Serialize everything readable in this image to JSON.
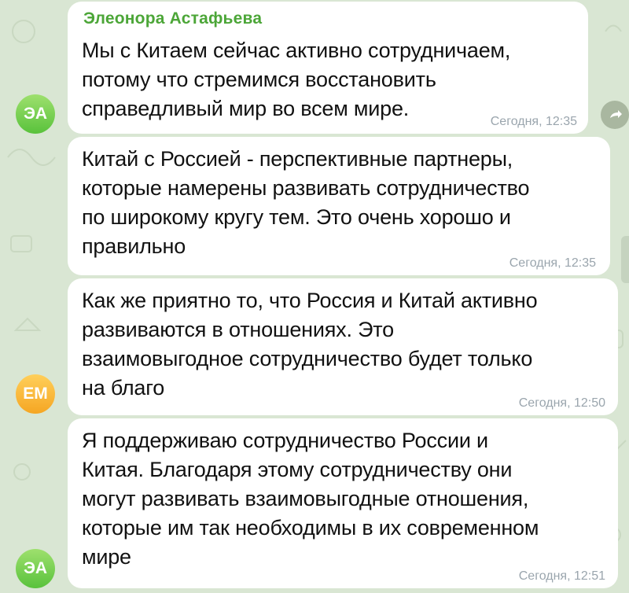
{
  "messages": [
    {
      "sender": "Элеонора Астафьева",
      "lines": [
        "Мы с Китаем сейчас активно сотрудничаем,",
        "потому что стремимся восстановить",
        "справедливый мир во всем мире."
      ],
      "time": "Сегодня, 12:35"
    },
    {
      "lines": [
        "Китай с Россией - перспективные партнеры,",
        "которые намерены развивать сотрудничество",
        "по широкому кругу тем. Это очень хорошо и",
        "правильно"
      ],
      "time": "Сегодня, 12:35"
    },
    {
      "lines": [
        "Как же приятно то, что Россия и Китай активно",
        "развиваются в отношениях. Это",
        "взаимовыгодное сотрудничество будет только",
        "на благо"
      ],
      "time": "Сегодня, 12:50"
    },
    {
      "lines": [
        "Я поддерживаю сотрудничество России и",
        "Китая. Благодаря этому сотрудничеству они",
        "могут развивать взаимовыгодные отношения,",
        "которые им так необходимы в их современном",
        "мире"
      ],
      "time": "Сегодня, 12:51"
    }
  ],
  "avatars": [
    {
      "initials": "ЭА",
      "color": "#6fcf4f"
    },
    {
      "initials": "ЕМ",
      "color": "#f5b83b"
    },
    {
      "initials": "ЭА",
      "color": "#6fcf4f"
    }
  ],
  "share_icon": "share-arrow-icon"
}
